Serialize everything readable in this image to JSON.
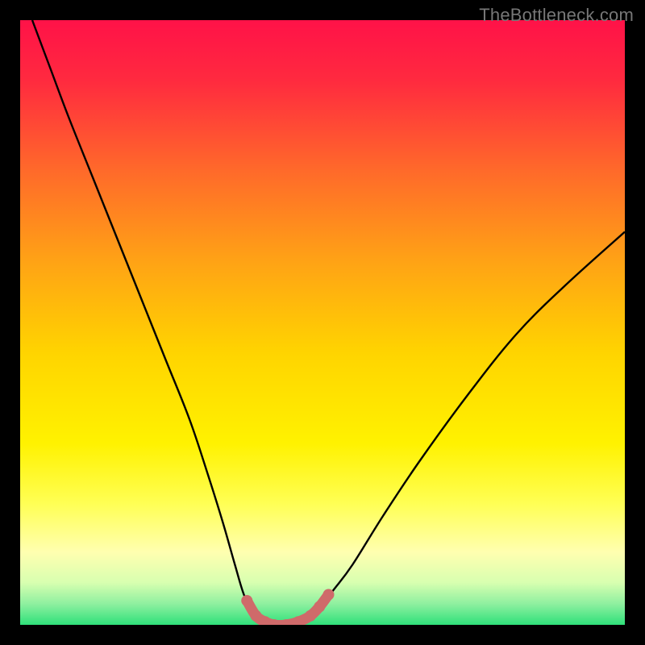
{
  "watermark": "TheBottleneck.com",
  "colors": {
    "frame": "#000000",
    "watermark": "#777777",
    "curve_stroke": "#000000",
    "highlight_stroke": "#cf6a6a",
    "gradient_stops": [
      {
        "offset": 0.0,
        "color": "#ff1248"
      },
      {
        "offset": 0.1,
        "color": "#ff2a3f"
      },
      {
        "offset": 0.25,
        "color": "#ff6a2a"
      },
      {
        "offset": 0.4,
        "color": "#ffa315"
      },
      {
        "offset": 0.55,
        "color": "#ffd400"
      },
      {
        "offset": 0.7,
        "color": "#fff200"
      },
      {
        "offset": 0.8,
        "color": "#ffff55"
      },
      {
        "offset": 0.88,
        "color": "#ffffb0"
      },
      {
        "offset": 0.93,
        "color": "#d8ffb0"
      },
      {
        "offset": 0.965,
        "color": "#8ff0a0"
      },
      {
        "offset": 1.0,
        "color": "#2fe07a"
      }
    ]
  },
  "chart_data": {
    "type": "line",
    "title": "",
    "xlabel": "",
    "ylabel": "",
    "xlim": [
      0,
      100
    ],
    "ylim": [
      0,
      100
    ],
    "grid": false,
    "series": [
      {
        "name": "bottleneck-curve",
        "x": [
          2,
          5,
          8,
          12,
          16,
          20,
          24,
          28,
          31,
          33.5,
          35.5,
          37,
          38.5,
          40,
          42,
          44,
          46,
          48,
          50,
          52,
          55,
          60,
          66,
          74,
          82,
          90,
          100
        ],
        "y": [
          100,
          92,
          84,
          74,
          64,
          54,
          44,
          34,
          25,
          17,
          10,
          5,
          2,
          0.5,
          0,
          0,
          0.5,
          1.5,
          3.5,
          6,
          10,
          18,
          27,
          38,
          48,
          56,
          65
        ]
      },
      {
        "name": "bottleneck-highlight",
        "x": [
          37.5,
          39,
          40.5,
          42,
          44,
          46,
          48,
          49.5,
          51
        ],
        "y": [
          4,
          1.5,
          0.5,
          0,
          0,
          0.5,
          1.5,
          3,
          5
        ]
      }
    ]
  }
}
